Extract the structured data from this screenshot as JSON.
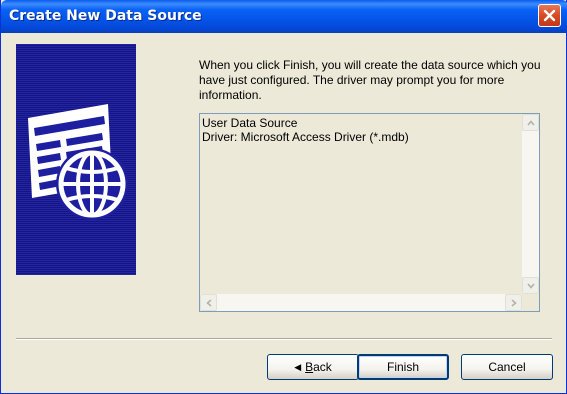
{
  "window": {
    "title": "Create New Data Source"
  },
  "art": {
    "icon": "database-globe-icon"
  },
  "description": "When you click Finish, you will create the data source which you have just configured.  The driver may prompt you for more information.",
  "summary": {
    "lines": [
      "User Data Source",
      "Driver:  Microsoft Access Driver (*.mdb)"
    ]
  },
  "buttons": {
    "back_prefix": "◀ ",
    "back_mnemonic": "B",
    "back_rest": "ack",
    "finish": "Finish",
    "cancel": "Cancel"
  }
}
